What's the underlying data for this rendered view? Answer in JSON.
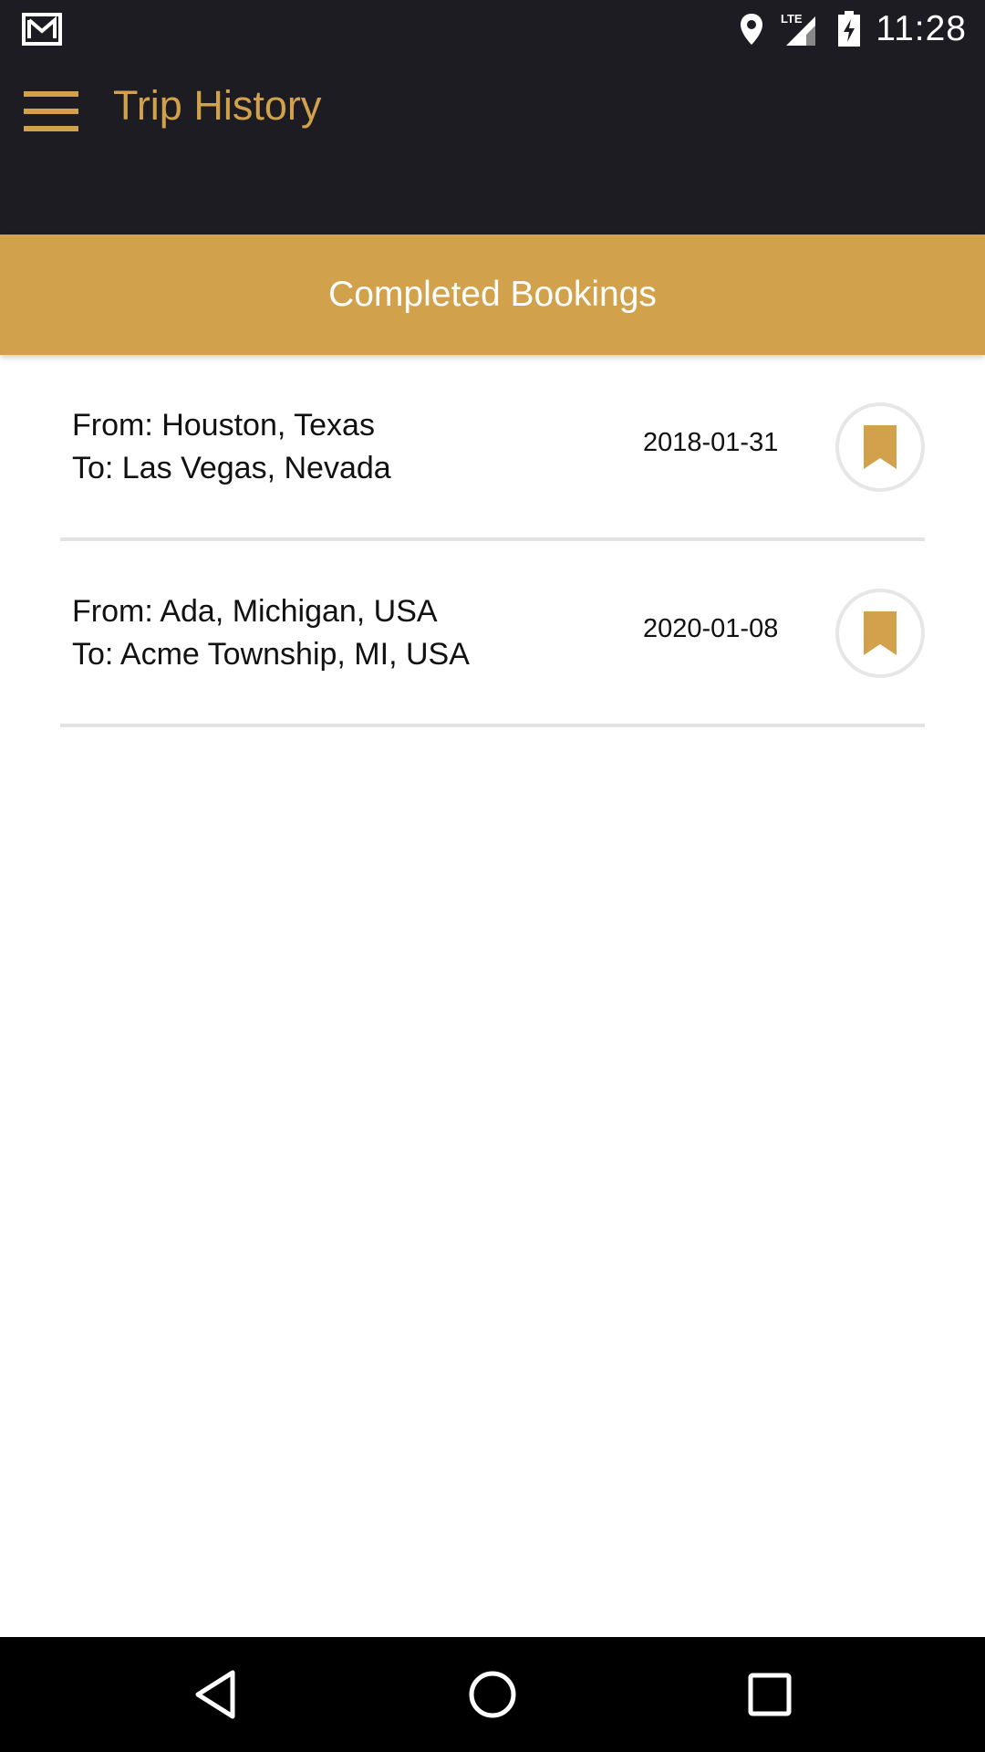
{
  "status_bar": {
    "time": "11:28",
    "network": "LTE",
    "icons": [
      "gmail-icon",
      "location-icon",
      "signal-icon",
      "battery-charging-icon"
    ]
  },
  "app_bar": {
    "title": "Trip History",
    "menu_icon": "hamburger-menu-icon"
  },
  "section": {
    "title": "Completed Bookings"
  },
  "bookings": [
    {
      "from": "From: Houston, Texas",
      "to": "To: Las Vegas, Nevada",
      "date": "2018-01-31",
      "icon": "bookmark-icon"
    },
    {
      "from": "From: Ada, Michigan, USA",
      "to": "To: Acme Township, MI, USA",
      "date": "2020-01-08",
      "icon": "bookmark-icon"
    }
  ],
  "nav_bar": {
    "icons": [
      "back-icon",
      "home-icon",
      "recents-icon"
    ]
  },
  "colors": {
    "accent": "#d1a24b",
    "app_bar_bg": "#1c1c22",
    "divider": "#e3e3e3"
  }
}
